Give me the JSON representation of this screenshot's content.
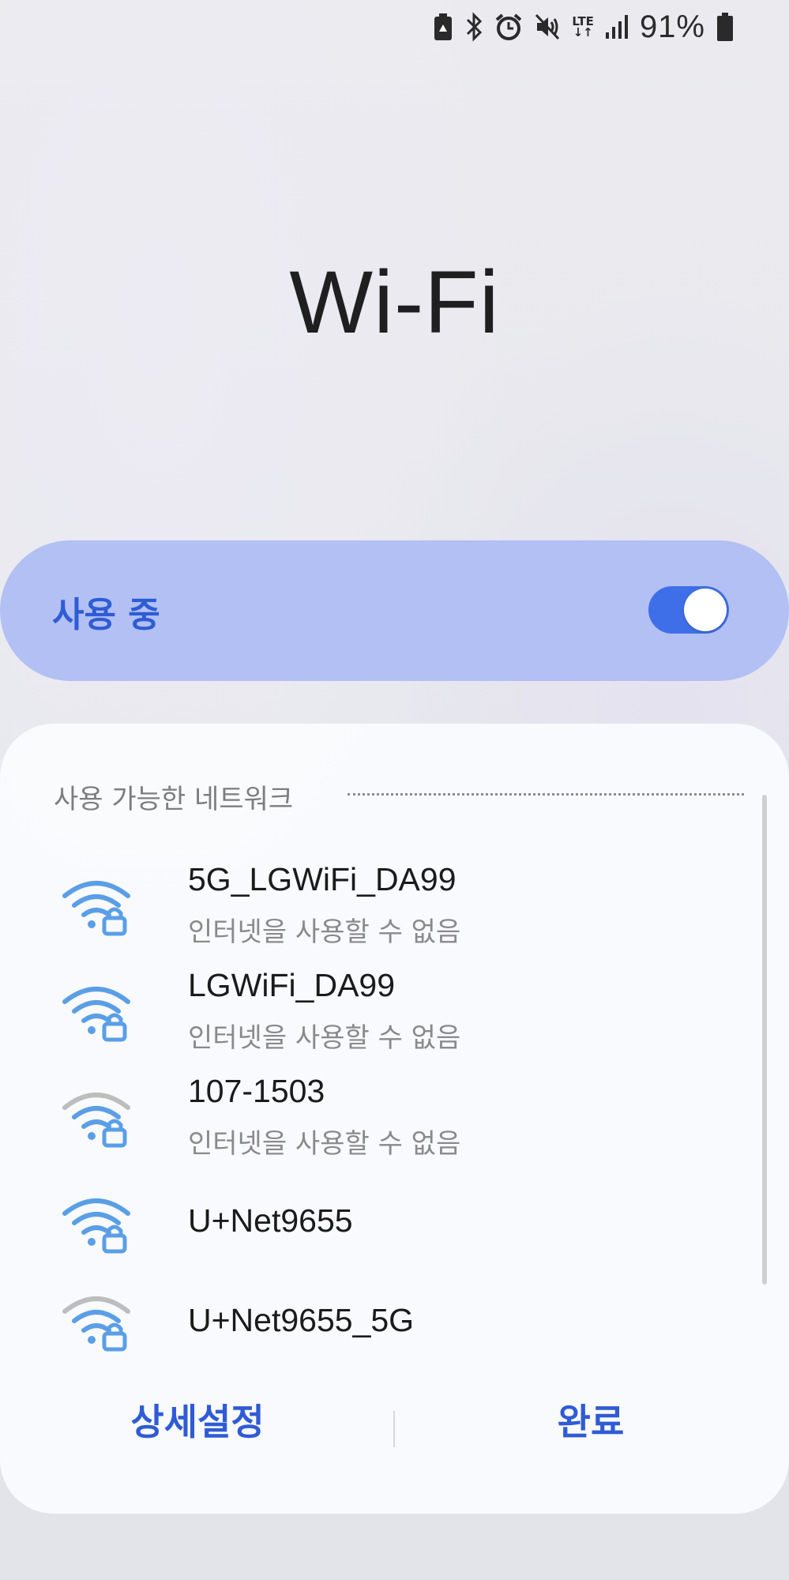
{
  "status_bar": {
    "icons": [
      "battery-saver-icon",
      "bluetooth-icon",
      "alarm-icon",
      "mute-icon",
      "lte-icon",
      "signal-icon",
      "battery-icon"
    ],
    "lte_label": "LTE",
    "battery_percent": "91%"
  },
  "title": "Wi-Fi",
  "wifi_toggle": {
    "label": "사용 중",
    "state": "on",
    "accent": "#3f6fe8"
  },
  "networks": {
    "header": "사용 가능한 네트워크",
    "items": [
      {
        "ssid": "5G_LGWiFi_DA99",
        "status": "인터넷을 사용할 수 없음",
        "secured": true,
        "signal_color": "#5a9fe6"
      },
      {
        "ssid": "LGWiFi_DA99",
        "status": "인터넷을 사용할 수 없음",
        "secured": true,
        "signal_color": "#5a9fe6"
      },
      {
        "ssid": "107-1503",
        "status": "인터넷을 사용할 수 없음",
        "secured": true,
        "signal_color": "#bdbdbd"
      },
      {
        "ssid": "U+Net9655",
        "status": "",
        "secured": true,
        "signal_color": "#5a9fe6"
      },
      {
        "ssid": "U+Net9655_5G",
        "status": "",
        "secured": true,
        "signal_color": "#bdbdbd"
      }
    ]
  },
  "actions": {
    "advanced_label": "상세설정",
    "done_label": "완료"
  }
}
